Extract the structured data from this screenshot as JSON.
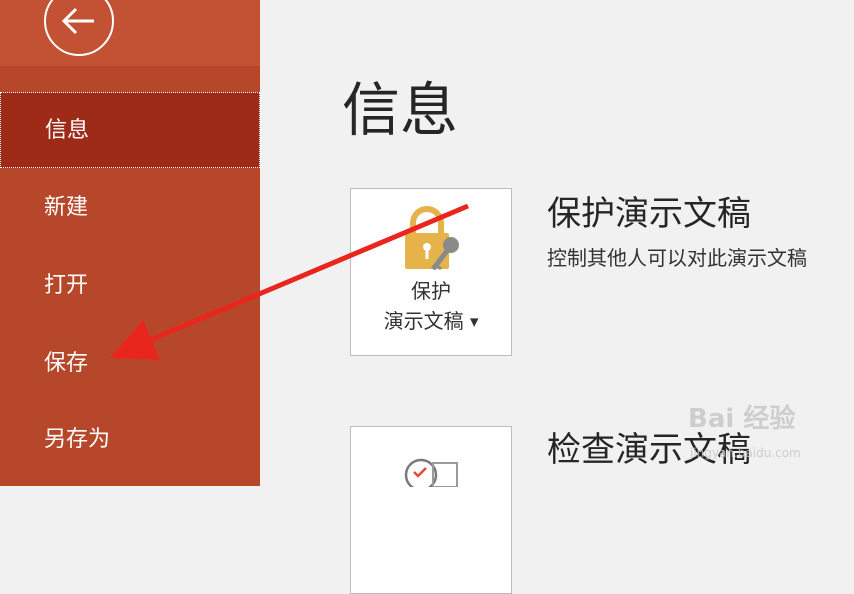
{
  "sidebar": {
    "back_label": "back",
    "items": [
      {
        "label": "信息",
        "selected": true
      },
      {
        "label": "新建",
        "selected": false
      },
      {
        "label": "打开",
        "selected": false
      },
      {
        "label": "保存",
        "selected": false
      },
      {
        "label": "另存为",
        "selected": false
      }
    ]
  },
  "main": {
    "title": "信息",
    "sections": [
      {
        "button_line1": "保护",
        "button_line2": "演示文稿",
        "title": "保护演示文稿",
        "description": "控制其他人可以对此演示文稿"
      },
      {
        "title": "检查演示文稿"
      }
    ]
  },
  "watermark": {
    "text": "Bai 经验",
    "sub": "jingyan.baidu.com"
  },
  "colors": {
    "sidebar_bg": "#b7472a",
    "sidebar_selected": "#9e2a18",
    "annotation_arrow": "#e8261d",
    "lock_icon": "#e6b34a"
  },
  "icons": [
    "back-arrow-icon",
    "lock-key-icon",
    "dropdown-caret-icon",
    "inspect-document-icon"
  ]
}
